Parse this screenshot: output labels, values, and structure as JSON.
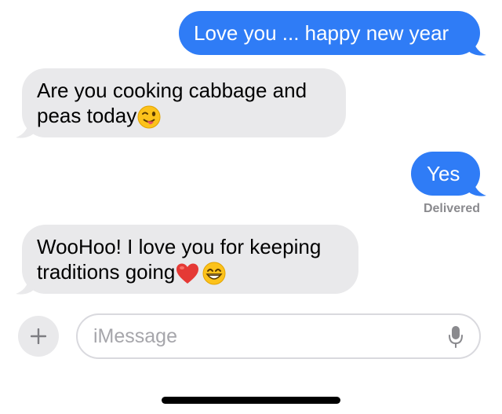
{
  "messages": [
    {
      "direction": "outgoing",
      "text": "Love you ... happy new year"
    },
    {
      "direction": "incoming",
      "text_line1": "Are you cooking cabbage and",
      "text_line2": "peas today",
      "emoji": [
        "winking-face-with-tongue"
      ]
    },
    {
      "direction": "outgoing",
      "text": "Yes",
      "status": "Delivered"
    },
    {
      "direction": "incoming",
      "text_line1": "WooHoo! I love you for keeping",
      "text_line2": "traditions going",
      "emoji": [
        "red-heart",
        "grinning-face"
      ]
    }
  ],
  "composer": {
    "placeholder": "iMessage",
    "value": "",
    "plus_icon": "plus-icon",
    "mic_icon": "microphone-icon"
  },
  "colors": {
    "outgoing_bubble": "#2f7cf6",
    "incoming_bubble": "#e9e9eb",
    "status_text": "#8a8a8e"
  }
}
